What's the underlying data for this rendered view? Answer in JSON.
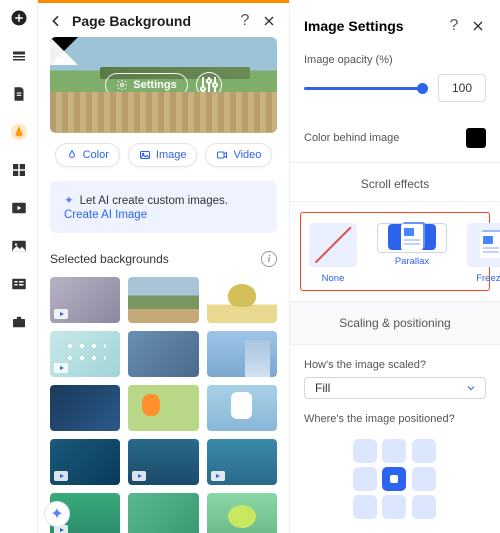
{
  "rail": {
    "items": [
      "add",
      "section",
      "page",
      "styles",
      "grid",
      "media",
      "image",
      "data",
      "apps"
    ]
  },
  "main": {
    "title": "Page Background",
    "hero": {
      "settings_label": "Settings"
    },
    "tabs": {
      "color": "Color",
      "image": "Image",
      "video": "Video"
    },
    "ai": {
      "text": "Let AI create custom images.",
      "link": "Create AI Image"
    },
    "selected_heading": "Selected backgrounds",
    "thumb_count": 15
  },
  "right": {
    "title": "Image Settings",
    "opacity": {
      "label": "Image opacity (%)",
      "value": "100"
    },
    "color_behind": {
      "label": "Color behind image",
      "value": "#000000"
    },
    "scroll": {
      "heading": "Scroll effects",
      "options": {
        "none": "None",
        "parallax": "Parallax",
        "freeze": "Freeze"
      },
      "selected": "parallax"
    },
    "scaling": {
      "heading": "Scaling & positioning",
      "scale_q": "How's the image scaled?",
      "scale_value": "Fill",
      "pos_q": "Where's the image positioned?",
      "pos_index": 4
    }
  }
}
